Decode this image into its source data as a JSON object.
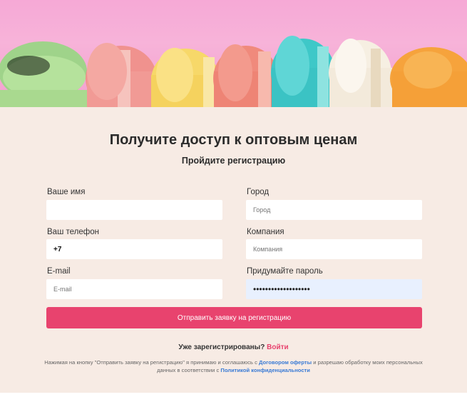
{
  "hero": {
    "image": "macarons-banner"
  },
  "heading": {
    "title": "Получите доступ к оптовым ценам",
    "subtitle": "Пройдите регистрацию"
  },
  "form": {
    "name": {
      "label": "Ваше имя",
      "value": "",
      "placeholder": ""
    },
    "city": {
      "label": "Город",
      "value": "",
      "placeholder": "Город"
    },
    "phone": {
      "label": "Ваш телефон",
      "value": "+7",
      "placeholder": ""
    },
    "company": {
      "label": "Компания",
      "value": "",
      "placeholder": "Компания"
    },
    "email": {
      "label": "E-mail",
      "value": "",
      "placeholder": "E-mail"
    },
    "password": {
      "label": "Придумайте пароль",
      "value": "•••••••••••••••••••"
    },
    "submit_label": "Отправить заявку на регистрацию"
  },
  "login": {
    "question": "Уже зарегистрированы?",
    "link": "Войти"
  },
  "consent": {
    "part1": "Нажимая на кнопку \"Отправить заявку на регистрацию\" я принимаю и соглашаюсь с ",
    "offer_link": "Договором оферты",
    "part2": " и разрешаю обработку моих персональных данных в соответствии с ",
    "privacy_link": "Политикой конфиденциальности"
  },
  "colors": {
    "accent": "#e8436e",
    "panel": "#f7ebe4",
    "link_blue": "#3a7bd5"
  }
}
